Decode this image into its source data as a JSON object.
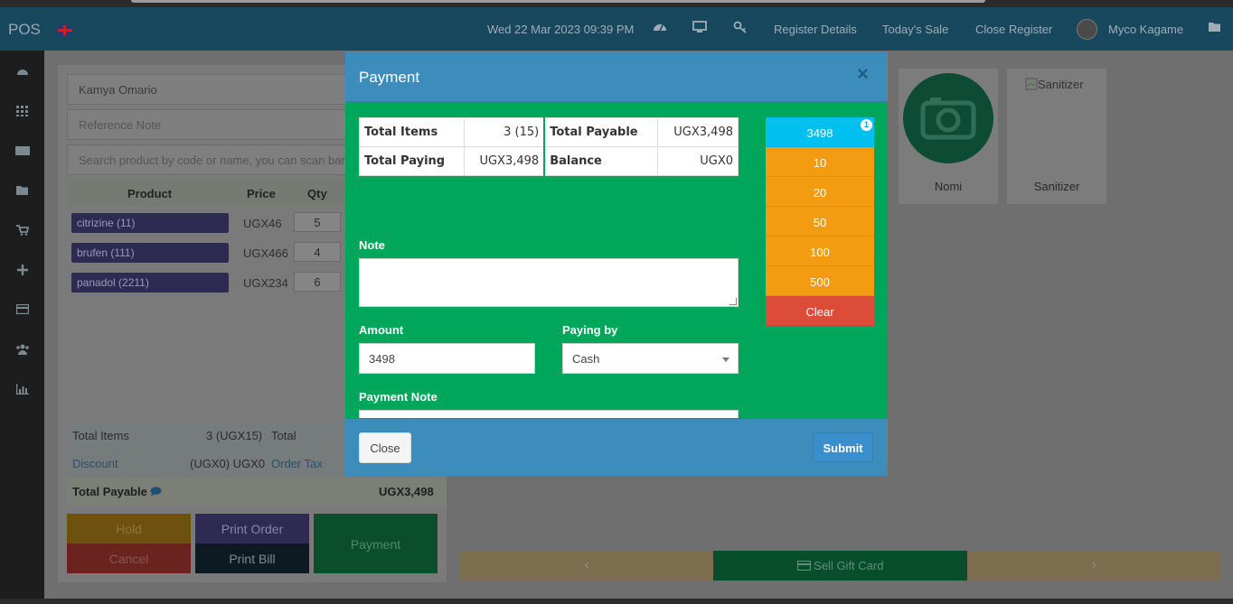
{
  "navbar": {
    "brand": "POS",
    "datetime": "Wed 22 Mar 2023 09:39 PM",
    "register_details": "Register Details",
    "todays_sale": "Today's Sale",
    "close_register": "Close Register",
    "user_name": "Myco Kagame"
  },
  "left": {
    "customer": "Kamya Omario",
    "reference_placeholder": "Reference Note",
    "search_placeholder": "Search product by code or name, you can scan bar",
    "cart_headers": {
      "product": "Product",
      "price": "Price",
      "qty": "Qty"
    },
    "cart": [
      {
        "product": "citrizine (11)",
        "price": "UGX46",
        "qty": "5"
      },
      {
        "product": "brufen (111)",
        "price": "UGX466",
        "qty": "4"
      },
      {
        "product": "panadol (2211)",
        "price": "UGX234",
        "qty": "6"
      }
    ],
    "totals": {
      "total_items_label": "Total Items",
      "total_items_value": "3 (UGX15)",
      "total_label": "Total",
      "discount_label": "Discount",
      "discount_value": "(UGX0) UGX0",
      "order_tax_label": "Order Tax",
      "total_payable_label": "Total Payable",
      "total_payable_value": "UGX3,498"
    },
    "buttons": {
      "hold": "Hold",
      "cancel": "Cancel",
      "print_order": "Print Order",
      "print_bill": "Print Bill",
      "payment": "Payment"
    }
  },
  "products": [
    {
      "name": "Nomi"
    },
    {
      "name": "Sanitizer",
      "alt": "Sanitizer"
    }
  ],
  "pager": {
    "prev": "‹",
    "sell_gift_card": "Sell Gift Card",
    "next": "›"
  },
  "modal": {
    "title": "Payment",
    "close_x": "×",
    "summary": {
      "total_items_label": "Total Items",
      "total_items_value": "3 (15)",
      "total_payable_label": "Total Payable",
      "total_payable_value": "UGX3,498",
      "total_paying_label": "Total Paying",
      "total_paying_value": "UGX3,498",
      "balance_label": "Balance",
      "balance_value": "UGX0"
    },
    "note_label": "Note",
    "amount_label": "Amount",
    "amount_value": "3498",
    "paying_by_label": "Paying by",
    "paying_by_value": "Cash",
    "payment_note_label": "Payment Note",
    "quick_cash": {
      "total": "3498",
      "badge": "1",
      "notes": [
        "10",
        "20",
        "50",
        "100",
        "500"
      ],
      "clear": "Clear"
    },
    "close_button": "Close",
    "submit_button": "Submit"
  },
  "colors": {
    "modal_header": "#3c8dbc",
    "modal_body": "#00a65a",
    "quick_total": "#00c0ef",
    "quick_note": "#f39c12",
    "clear": "#dd4b39"
  }
}
